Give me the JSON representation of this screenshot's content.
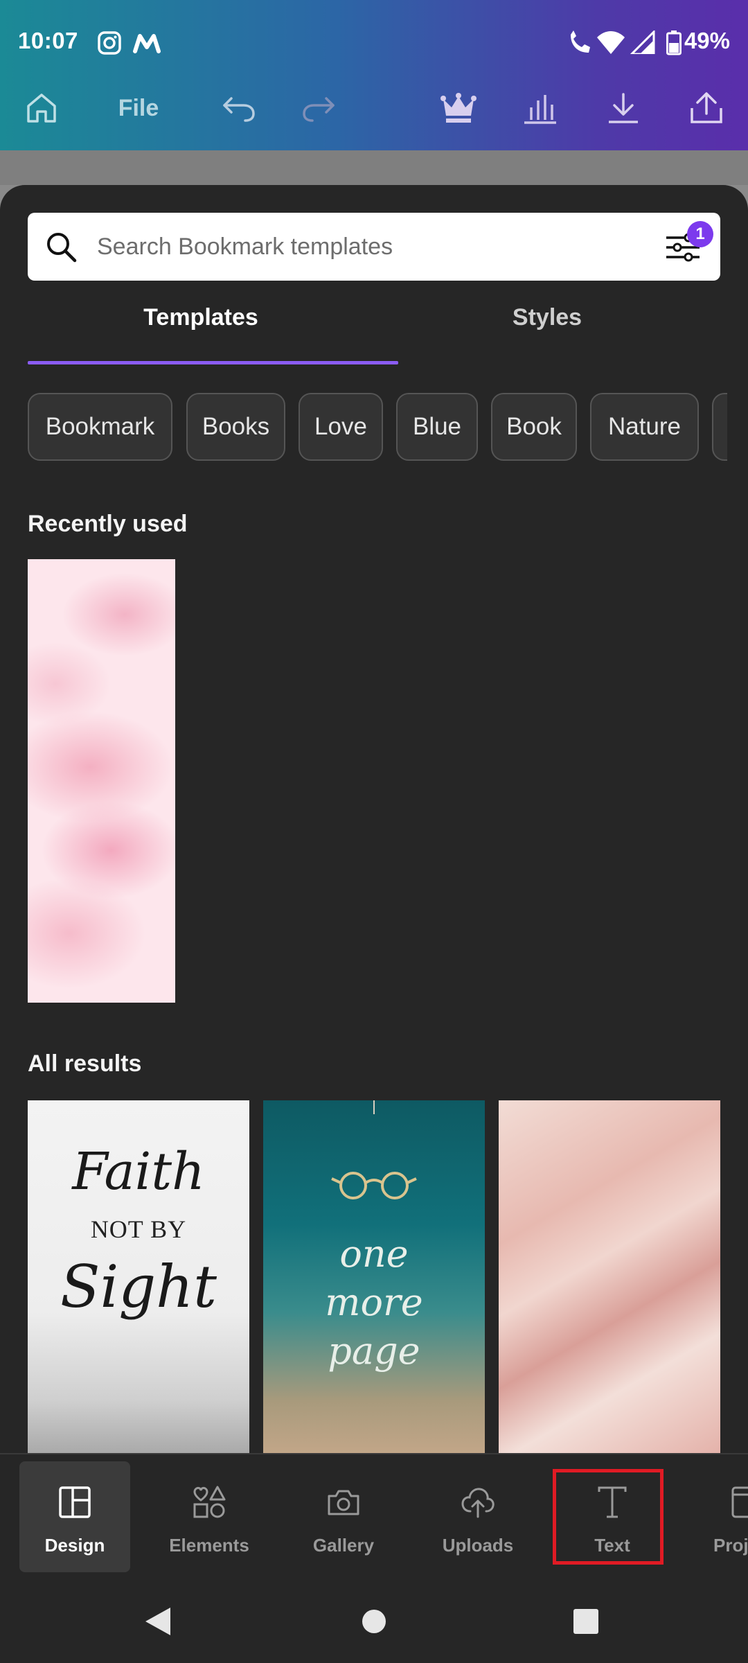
{
  "status_bar": {
    "time": "10:07",
    "battery": "49%"
  },
  "toolbar": {
    "file_label": "File"
  },
  "search": {
    "placeholder": "Search Bookmark templates",
    "filter_badge": "1"
  },
  "tabs": [
    {
      "label": "Templates",
      "active": true
    },
    {
      "label": "Styles",
      "active": false
    }
  ],
  "chips": [
    "Bookmark",
    "Books",
    "Love",
    "Blue",
    "Book",
    "Nature"
  ],
  "sections": {
    "recent_title": "Recently used",
    "all_title": "All results"
  },
  "results": {
    "r1_line1": "Faith",
    "r1_line2": "NOT BY",
    "r1_line3": "Sight",
    "r2_line1": "one",
    "r2_line2": "more",
    "r2_line3": "page"
  },
  "bottom_nav": [
    {
      "label": "Design",
      "icon": "layout-icon",
      "active": true
    },
    {
      "label": "Elements",
      "icon": "shapes-icon",
      "active": false
    },
    {
      "label": "Gallery",
      "icon": "camera-icon",
      "active": false
    },
    {
      "label": "Uploads",
      "icon": "cloud-upload-icon",
      "active": false
    },
    {
      "label": "Text",
      "icon": "text-icon",
      "active": false
    },
    {
      "label": "Proj",
      "icon": "projects-icon",
      "active": false
    }
  ],
  "colors": {
    "accent": "#8b5cf6",
    "highlight": "#e01b24"
  }
}
